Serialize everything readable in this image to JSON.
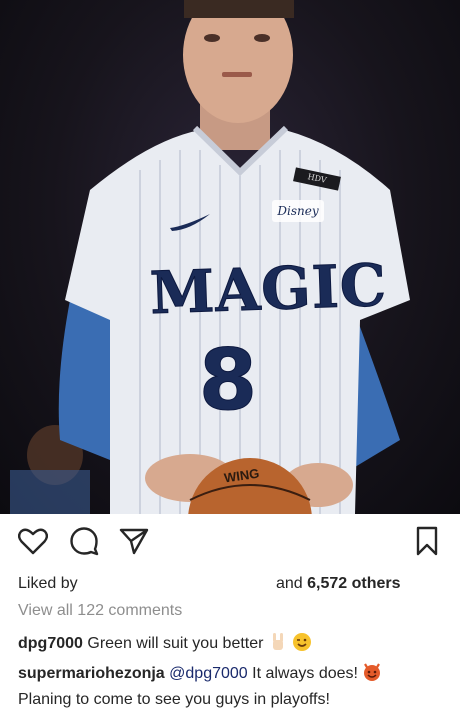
{
  "photo": {
    "jersey_wordmark": "MAGIC",
    "jersey_number": "8",
    "sponsor_patch": "Disney",
    "collar_tag": "HDV",
    "ball_text": "WING"
  },
  "actions": {
    "like_icon": "heart-icon",
    "comment_icon": "comment-icon",
    "share_icon": "share-icon",
    "save_icon": "bookmark-icon"
  },
  "likes": {
    "liked_by_label": "Liked by",
    "and_label": "and",
    "others_count": "6,572 others"
  },
  "view_all_comments": "View all 122 comments",
  "comments": [
    {
      "user": "dpg7000",
      "text": "Green will suit you better"
    },
    {
      "user": "supermariohezonja",
      "mention": "@dpg7000",
      "text": "It always does!",
      "text2": "Planing to come to see you guys in playoffs!"
    }
  ],
  "colors": {
    "text": "#262626",
    "muted": "#8e8e8e",
    "jersey_navy": "#1a2b57",
    "sleeve_blue": "#3a6db3"
  }
}
